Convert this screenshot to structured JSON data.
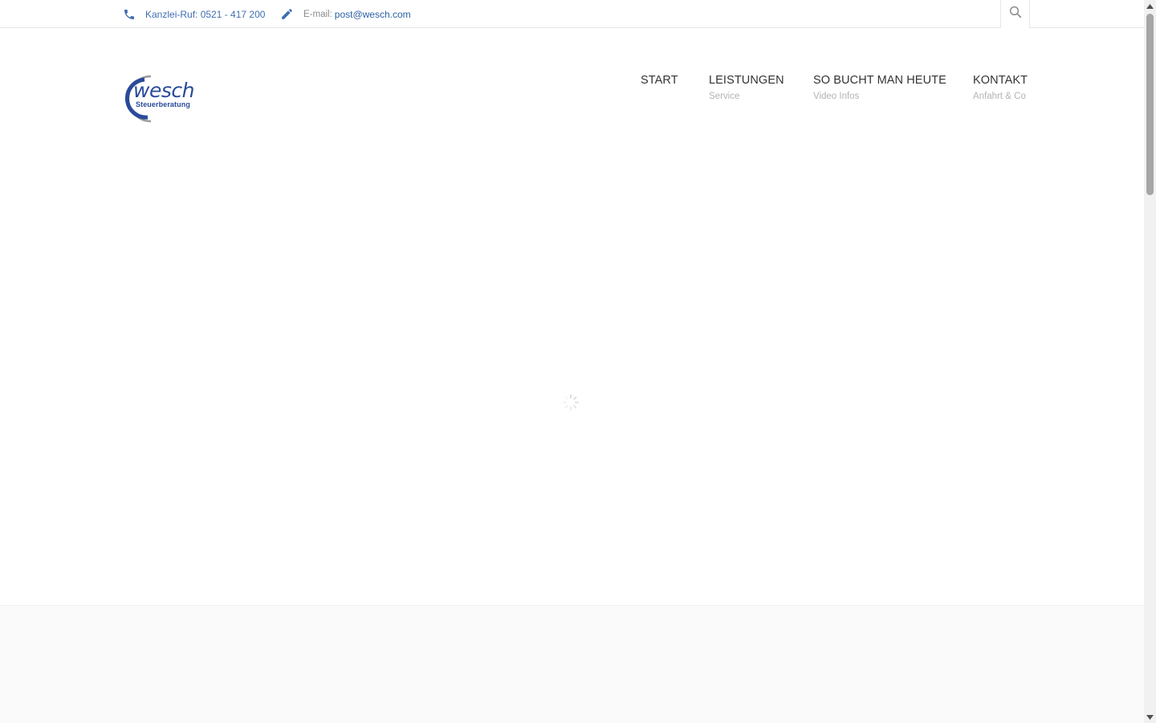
{
  "topbar": {
    "phone_text": "Kanzlei-Ruf: 0521 - 417 200",
    "email_label": "E-mail:",
    "email_address": "post@wesch.com",
    "phone_icon": "phone-icon",
    "email_icon": "pencil-icon",
    "search_icon": "search-icon"
  },
  "logo": {
    "brand": "wesch",
    "tagline": "Steuerberatung"
  },
  "nav": {
    "items": [
      {
        "label": "START",
        "sub": ""
      },
      {
        "label": "LEISTUNGEN",
        "sub": "Service"
      },
      {
        "label": "SO BUCHT MAN HEUTE",
        "sub": "Video Infos"
      },
      {
        "label": "KONTAKT",
        "sub": "Anfahrt & Co"
      }
    ]
  },
  "colors": {
    "accent_blue": "#2a4a9a",
    "link_blue": "#3f6fb0",
    "nav_text": "#333333",
    "nav_sub": "#b3b3b3",
    "footer_bg": "#fafafa"
  }
}
